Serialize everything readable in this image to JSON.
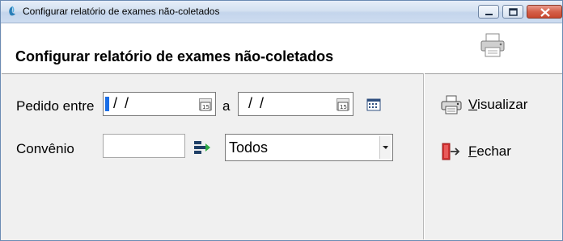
{
  "window": {
    "title": "Configurar relatório de exames não-coletados"
  },
  "header": {
    "title": "Configurar relatório de exames não-coletados"
  },
  "form": {
    "pedido_label": "Pedido entre",
    "date_from": "/ /",
    "between_label": "a",
    "date_to": "/ /",
    "convenio_label": "Convênio",
    "convenio_code": "",
    "convenio_select": "Todos"
  },
  "actions": {
    "visualizar_first": "V",
    "visualizar_rest": "isualizar",
    "fechar_first": "F",
    "fechar_rest": "echar"
  },
  "icons": {
    "app": "app-icon",
    "printer": "printer-icon",
    "calendar": "calendar-icon",
    "lookup": "lookup-icon",
    "exit": "exit-door-icon"
  },
  "colors": {
    "caret": "#1a6ee6",
    "close_button": "#c7472f",
    "lookup_green": "#2eaa44",
    "lookup_navy": "#1f3f66",
    "exit_red": "#d32f2f"
  }
}
